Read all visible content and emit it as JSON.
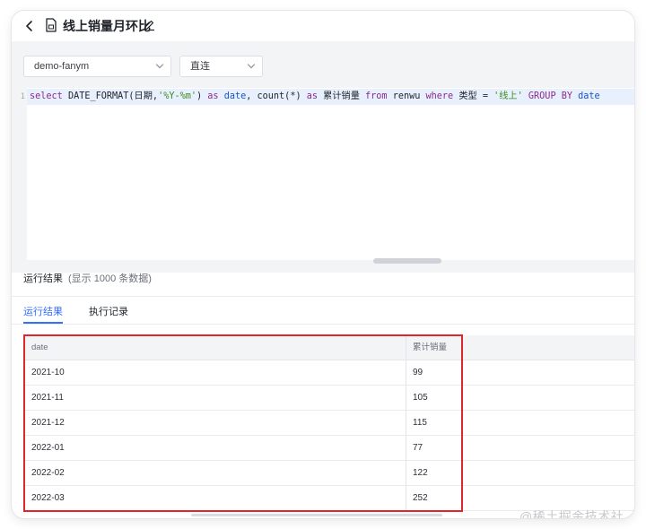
{
  "header": {
    "title": "线上销量月环比"
  },
  "toolbar": {
    "datasource": "demo-fanym",
    "mode": "直连"
  },
  "editor": {
    "line_number": "1",
    "tokens": {
      "t1": "select",
      "t2": " DATE_FORMAT(日期,",
      "t3": "'%Y-%m'",
      "t4": ") ",
      "t5": "as",
      "t6": " ",
      "t7": "date",
      "t8": ", count(*) ",
      "t9": "as",
      "t10": " 累计销量 ",
      "t11": "from",
      "t12": " renwu ",
      "t13": "where",
      "t14": " 类型 = ",
      "t15": "'线上'",
      "t16": " ",
      "t17": "GROUP BY",
      "t18": " ",
      "t19": "date"
    }
  },
  "results": {
    "title": "运行结果",
    "subtitle": "(显示 1000 条数据)",
    "tabs": [
      {
        "label": "运行结果"
      },
      {
        "label": "执行记录"
      }
    ],
    "columns": [
      "date",
      "累计销量"
    ],
    "rows": [
      {
        "date": "2021-10",
        "value": "99"
      },
      {
        "date": "2021-11",
        "value": "105"
      },
      {
        "date": "2021-12",
        "value": "115"
      },
      {
        "date": "2022-01",
        "value": "77"
      },
      {
        "date": "2022-02",
        "value": "122"
      },
      {
        "date": "2022-03",
        "value": "252"
      }
    ]
  },
  "watermark": "@稀土掘金技术社区",
  "colors": {
    "accent": "#3370ff",
    "highlight": "#e0262b",
    "keyword": "#8a2a8c",
    "string": "#3b8a1d",
    "identifier": "#1a53c4"
  }
}
